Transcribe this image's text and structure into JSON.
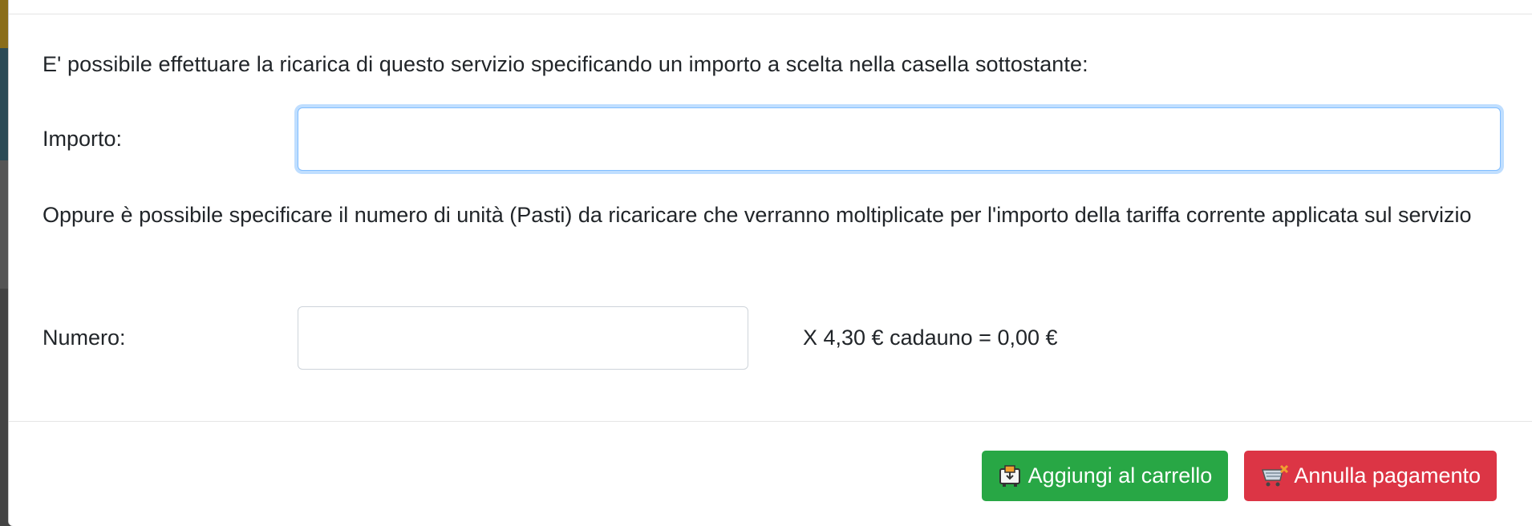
{
  "modal": {
    "intro_text": "E' possibile effettuare la ricarica di questo servizio specificando un importo a scelta nella casella sottostante:",
    "importo": {
      "label": "Importo:",
      "value": ""
    },
    "oppure_text": "Oppure è possibile specificare il numero di unità (Pasti) da ricaricare che verranno moltiplicate per l'importo della tariffa corrente applicata sul servizio",
    "numero": {
      "label": "Numero:",
      "value": ""
    },
    "calculation_text": "X 4,30 € cadauno = 0,00 €"
  },
  "footer": {
    "add_to_cart_label": "Aggiungi al carrello",
    "add_to_cart_icon": "cart-add-icon",
    "cancel_payment_label": "Annulla pagamento",
    "cancel_payment_icon": "cart-cancel-icon"
  },
  "colors": {
    "primary_green": "#28a745",
    "danger_red": "#dc3545",
    "focus_blue": "#80bdff",
    "text": "#212529"
  }
}
